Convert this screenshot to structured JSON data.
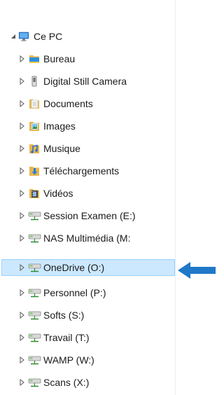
{
  "tree": {
    "root": {
      "label": "Ce PC",
      "icon": "pc-icon"
    },
    "items": [
      {
        "label": "Bureau",
        "icon": "desktop-folder-icon"
      },
      {
        "label": "Digital Still Camera",
        "icon": "camera-icon"
      },
      {
        "label": "Documents",
        "icon": "documents-folder-icon"
      },
      {
        "label": "Images",
        "icon": "pictures-folder-icon"
      },
      {
        "label": "Musique",
        "icon": "music-folder-icon"
      },
      {
        "label": "Téléchargements",
        "icon": "downloads-folder-icon"
      },
      {
        "label": "Vidéos",
        "icon": "videos-folder-icon"
      },
      {
        "label": "Session Examen (E:)",
        "icon": "network-drive-icon"
      },
      {
        "label": "NAS Multimédia (M:",
        "icon": "network-drive-icon"
      },
      {
        "label": "OneDrive (O:)",
        "icon": "network-drive-icon",
        "selected": true
      },
      {
        "label": "Personnel (P:)",
        "icon": "network-drive-icon"
      },
      {
        "label": "Softs (S:)",
        "icon": "network-drive-icon"
      },
      {
        "label": "Travail (T:)",
        "icon": "network-drive-icon"
      },
      {
        "label": "WAMP (W:)",
        "icon": "network-drive-icon"
      },
      {
        "label": "Scans (X:)",
        "icon": "network-drive-icon"
      }
    ]
  },
  "colors": {
    "selection_bg": "#cce8ff",
    "selection_border": "#99d1ff",
    "annotation_arrow": "#1f78c8"
  }
}
